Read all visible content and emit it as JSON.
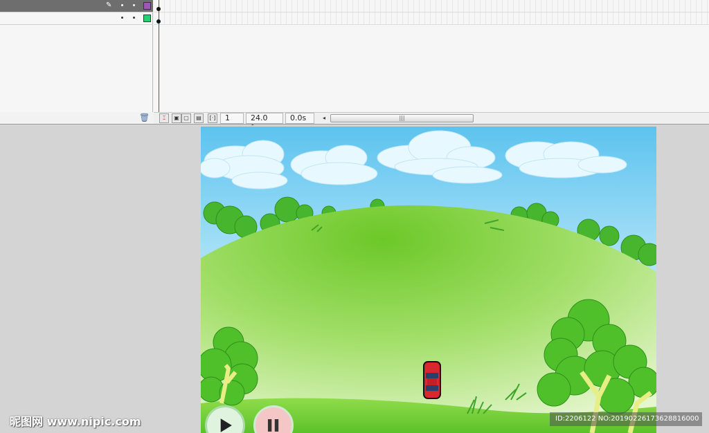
{
  "timeline": {
    "layers": [
      {
        "selected": true,
        "color": "#9b59b6",
        "icon": "pencil-icon"
      },
      {
        "selected": false,
        "color": "#2ecc71",
        "icon": ""
      }
    ],
    "status": {
      "current_frame": "1",
      "frame_rate": "24.0 fps",
      "elapsed_time": "0.0s"
    },
    "icons": {
      "pencil": "✎",
      "trash": "🗑",
      "scroll_left": "◂",
      "scroll_thumb": "|||"
    }
  },
  "stage": {
    "sky_color_top": "#5cc3ee",
    "hill_color": "#7dd23a",
    "car_color": "#d8282f",
    "play_icon": "play-icon",
    "pause_icon": "pause-icon"
  },
  "watermark": {
    "site": "昵图网 www.nipic.com",
    "id_text": "ID:2206122 NO:20190226173628816000"
  }
}
